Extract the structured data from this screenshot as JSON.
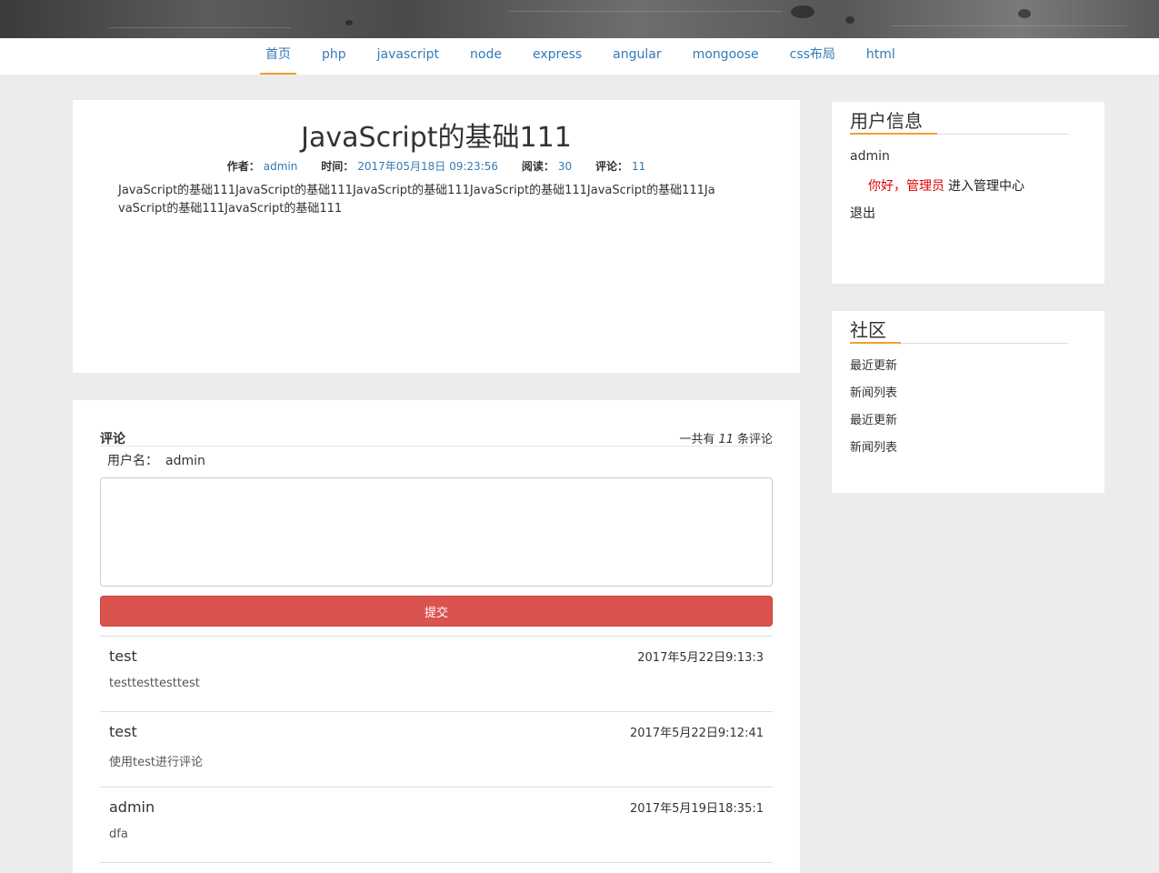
{
  "nav": {
    "items": [
      "首页",
      "php",
      "javascript",
      "node",
      "express",
      "angular",
      "mongoose",
      "css布局",
      "html"
    ],
    "active_index": 0
  },
  "article": {
    "title": "JavaScript的基础111",
    "author_label": "作者：",
    "author": "admin",
    "time_label": "时间：",
    "time": "2017年05月18日 09:23:56",
    "reads_label": "阅读：",
    "reads": "30",
    "comments_label": "评论：",
    "comments": "11",
    "body": "JavaScript的基础111JavaScript的基础111JavaScript的基础111JavaScript的基础111JavaScript的基础111JavaScript的基础111JavaScript的基础111"
  },
  "comments": {
    "title": "评论",
    "count_prefix": "一共有",
    "count": "11",
    "count_suffix": "条评论",
    "user_label": "用户名：",
    "user": "admin",
    "textarea_value": "",
    "submit_label": "提交",
    "items": [
      {
        "name": "test",
        "time": "2017年5月22日9:13:3",
        "text": "testtesttesttest"
      },
      {
        "name": "test",
        "time": "2017年5月22日9:12:41",
        "text": "使用test进行评论"
      },
      {
        "name": "admin",
        "time": "2017年5月19日18:35:1",
        "text": "dfa"
      }
    ]
  },
  "sidebar": {
    "user_info": {
      "title": "用户信息",
      "username": "admin",
      "greeting": "你好，管理员",
      "admin_link": "进入管理中心",
      "logout": "退出"
    },
    "community": {
      "title": "社区",
      "items": [
        "最近更新",
        "新闻列表",
        "最近更新",
        "新闻列表"
      ]
    }
  },
  "colors": {
    "link": "#337ab7",
    "accent": "#f0a030",
    "submit": "#d9534f",
    "greeting": "#dd0000",
    "background": "#ececec"
  }
}
